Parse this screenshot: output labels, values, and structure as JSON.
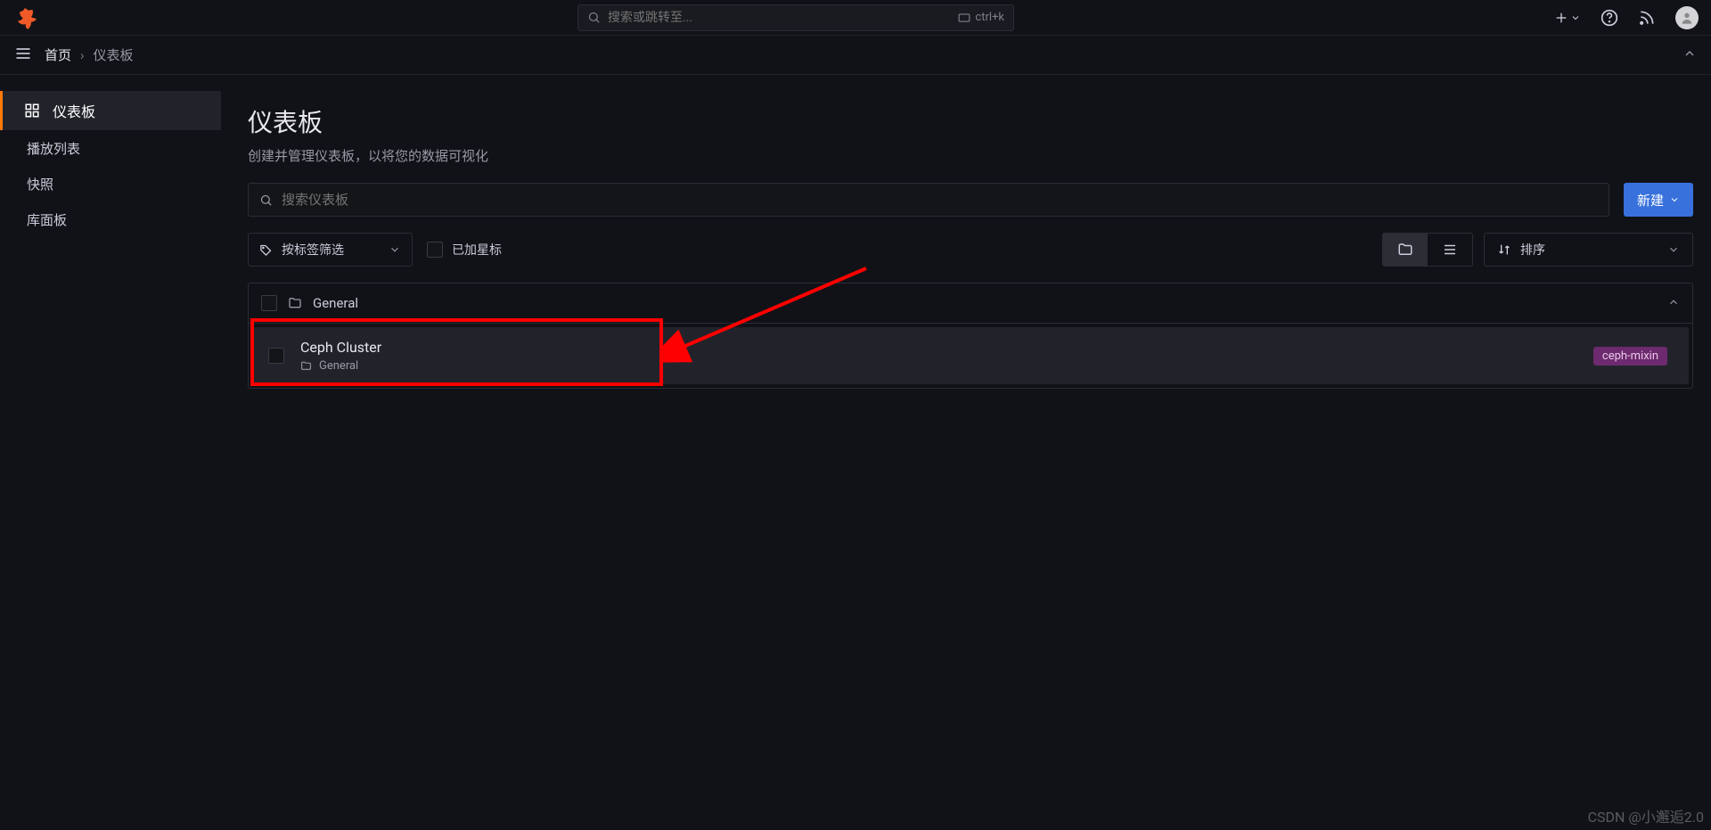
{
  "topbar": {
    "search_placeholder": "搜索或跳转至...",
    "kbd_hint": "ctrl+k"
  },
  "breadcrumb": {
    "home": "首页",
    "current": "仪表板"
  },
  "sidebar": {
    "items": [
      {
        "label": "仪表板"
      },
      {
        "label": "播放列表"
      },
      {
        "label": "快照"
      },
      {
        "label": "库面板"
      }
    ]
  },
  "page": {
    "title": "仪表板",
    "subtitle": "创建并管理仪表板，以将您的数据可视化",
    "search_placeholder": "搜索仪表板",
    "new_button": "新建",
    "tag_filter": "按标签筛选",
    "starred_label": "已加星标",
    "sort_label": "排序"
  },
  "folder": {
    "name": "General"
  },
  "dashboard_item": {
    "title": "Ceph Cluster",
    "folder": "General",
    "tag": "ceph-mixin"
  },
  "watermark": "CSDN @小邂逅2.0"
}
